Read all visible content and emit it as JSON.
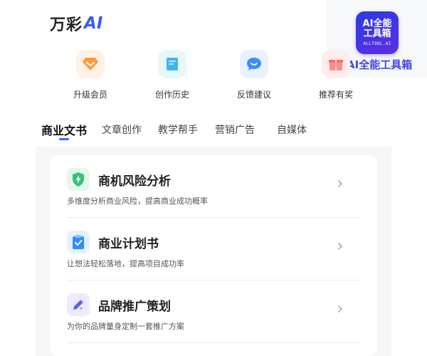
{
  "header": {
    "logo_text": "万彩",
    "logo_ai": "AI"
  },
  "watermark": {
    "badge_line1": "AI全能",
    "badge_line2": "工具箱",
    "badge_line3": "ALLTOOL.AI",
    "text": "AI全能工具箱"
  },
  "quick_actions": [
    {
      "label": "升级会员",
      "icon": "diamond-icon"
    },
    {
      "label": "创作历史",
      "icon": "document-icon"
    },
    {
      "label": "反馈建议",
      "icon": "chat-bubble-icon"
    },
    {
      "label": "推荐有奖",
      "icon": "gift-icon"
    }
  ],
  "tabs": [
    {
      "label": "商业文书",
      "active": true
    },
    {
      "label": "文章创作"
    },
    {
      "label": "教学帮手"
    },
    {
      "label": "营销广告"
    },
    {
      "label": "自媒体"
    }
  ],
  "items": [
    {
      "title": "商机风险分析",
      "desc": "多维度分析商业风险，提高商业成功概率",
      "icon": "shield-bolt-icon"
    },
    {
      "title": "商业计划书",
      "desc": "让想法轻松落地，提高项目成功率",
      "icon": "clipboard-check-icon"
    },
    {
      "title": "品牌推广策划",
      "desc": "为你的品牌量身定制一套推广方案",
      "icon": "pencil-icon"
    }
  ],
  "colors": {
    "accent": "#2f6bff",
    "brand": "#3a5cf5"
  }
}
